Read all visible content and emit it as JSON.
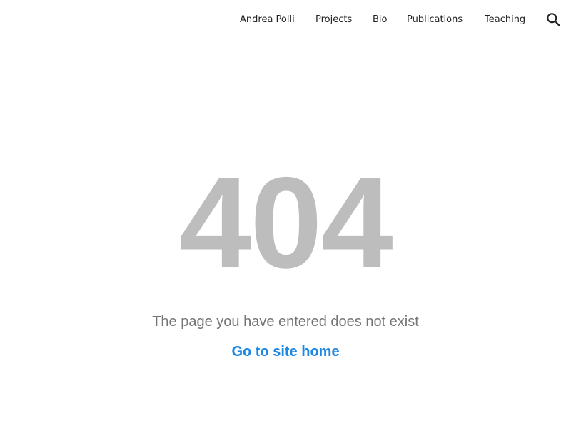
{
  "nav": {
    "items": [
      {
        "label": "Andrea Polli"
      },
      {
        "label": "Projects"
      },
      {
        "label": "Bio"
      },
      {
        "label": "Publications"
      },
      {
        "label": "Teaching"
      }
    ],
    "search_icon": "search-icon"
  },
  "error": {
    "code": "404",
    "message": "The page you have entered does not exist",
    "home_link_label": "Go to site home"
  },
  "colors": {
    "accent": "#1e88e5",
    "error_code": "#bdbdbd",
    "message": "#757575",
    "nav_text": "#212121"
  }
}
